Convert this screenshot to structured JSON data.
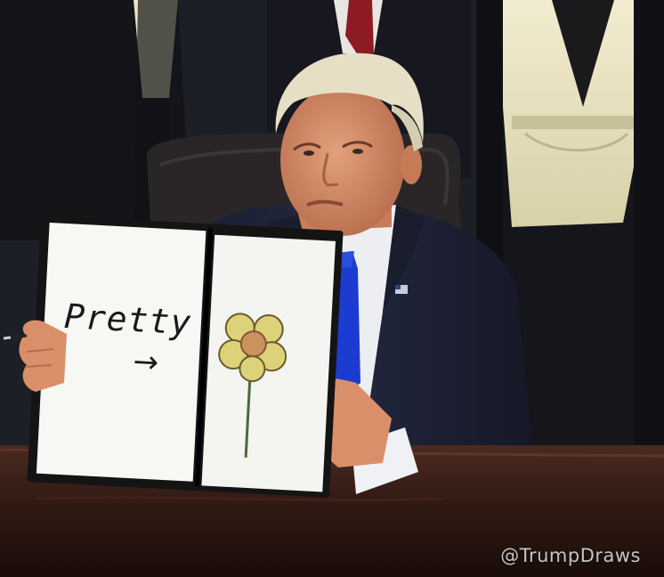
{
  "card": {
    "left_word": "Pretty",
    "arrow": "→"
  },
  "watermark": {
    "text": "@TrumpDraws"
  },
  "colors": {
    "suit": "#1e2233",
    "tie": "#1c3bd0",
    "desk": "#3a1d16",
    "paper": "#f7f7f4",
    "folder": "#141414",
    "flower_petal": "#dcd27a",
    "flower_center": "#c9925f",
    "hair": "#e6dfc6",
    "skin": "#d9906a"
  }
}
